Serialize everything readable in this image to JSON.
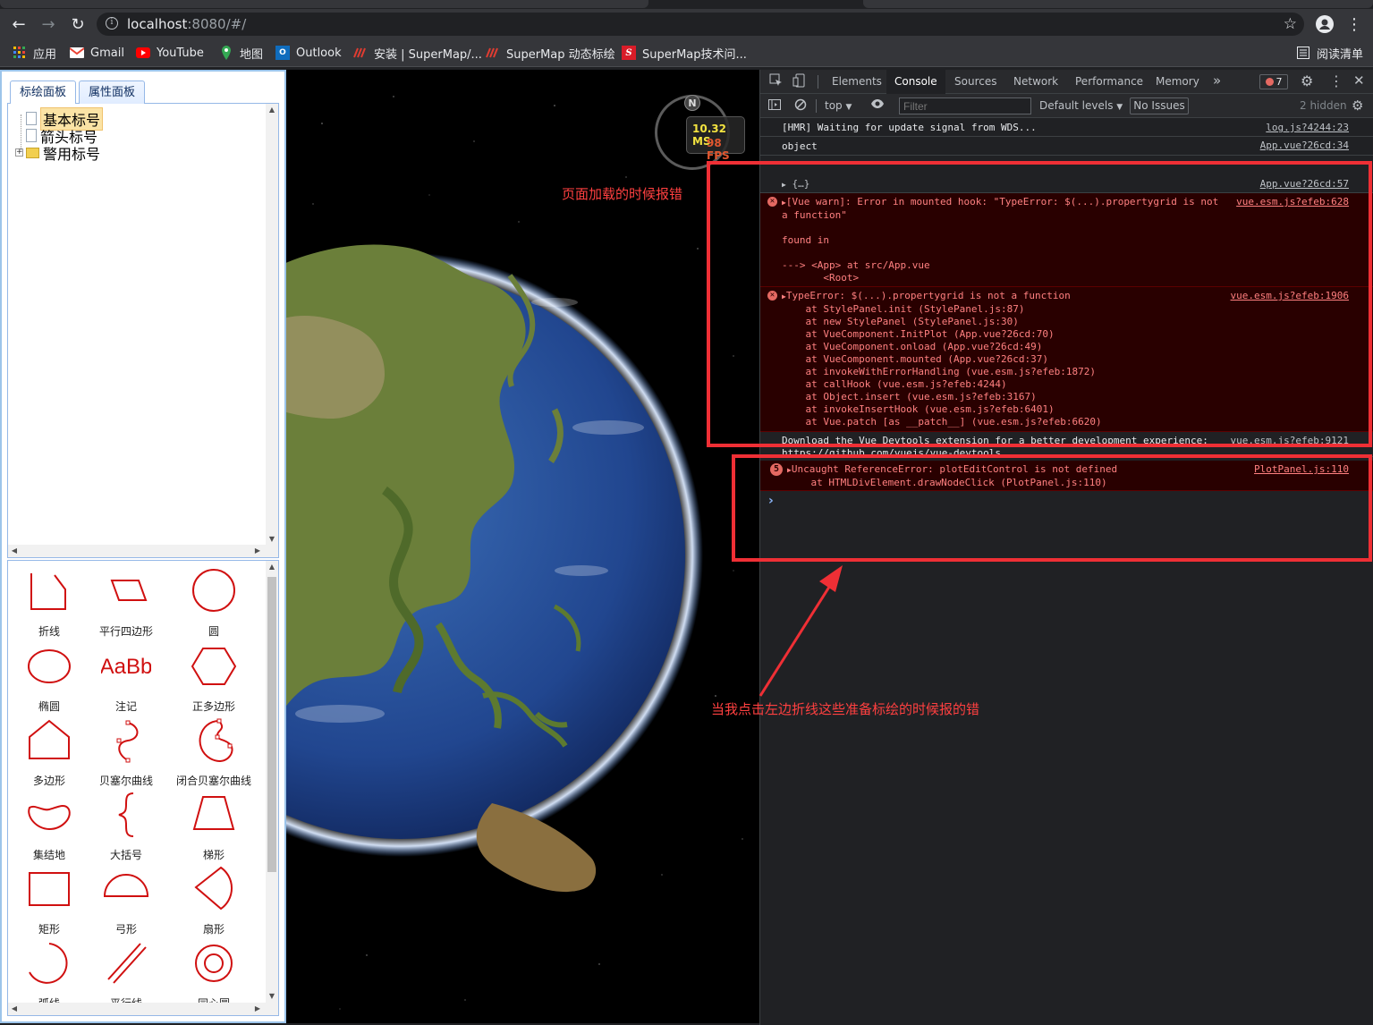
{
  "browser": {
    "url_host": "localhost",
    "url_path": ":8080/#/",
    "bookmarks": [
      {
        "label": "应用",
        "icon": "apps-grid-icon",
        "color": "#fbbc04"
      },
      {
        "label": "Gmail",
        "icon": "gmail-icon",
        "color": "#ea4335"
      },
      {
        "label": "YouTube",
        "icon": "youtube-icon",
        "color": "#ff0000"
      },
      {
        "label": "地图",
        "icon": "maps-icon",
        "color": "#34a853"
      },
      {
        "label": "Outlook",
        "icon": "outlook-icon",
        "color": "#0f6cbd"
      },
      {
        "label": "安装 | SuperMap/...",
        "icon": "supermap-icon",
        "color": "#e03c31"
      },
      {
        "label": "SuperMap 动态标绘",
        "icon": "supermap-icon",
        "color": "#e03c31"
      },
      {
        "label": "SuperMap技术问...",
        "icon": "supermap-s-icon",
        "color": "#d91c28"
      }
    ],
    "reading_list": "阅读清单"
  },
  "left_panel": {
    "tabs": [
      {
        "label": "标绘面板"
      },
      {
        "label": "属性面板"
      }
    ],
    "tree": [
      {
        "label": "基本标号",
        "type": "file",
        "selected": true
      },
      {
        "label": "箭头标号",
        "type": "file",
        "selected": false
      },
      {
        "label": "警用标号",
        "type": "folder",
        "selected": false
      }
    ],
    "gallery": [
      {
        "label": "折线",
        "icon": "polyline-icon"
      },
      {
        "label": "平行四边形",
        "icon": "parallelogram-icon"
      },
      {
        "label": "圆",
        "icon": "circle-icon"
      },
      {
        "label": "椭圆",
        "icon": "ellipse-icon"
      },
      {
        "label": "注记",
        "icon": "text-annotation-icon",
        "text": "AaBb"
      },
      {
        "label": "正多边形",
        "icon": "hexagon-icon"
      },
      {
        "label": "多边形",
        "icon": "polygon-icon"
      },
      {
        "label": "贝塞尔曲线",
        "icon": "bezier-curve-icon"
      },
      {
        "label": "闭合贝塞尔曲线",
        "icon": "closed-bezier-icon"
      },
      {
        "label": "集结地",
        "icon": "assembly-area-icon"
      },
      {
        "label": "大括号",
        "icon": "brace-icon"
      },
      {
        "label": "梯形",
        "icon": "trapezoid-icon"
      },
      {
        "label": "矩形",
        "icon": "rectangle-icon"
      },
      {
        "label": "弓形",
        "icon": "bow-icon"
      },
      {
        "label": "扇形",
        "icon": "sector-icon"
      },
      {
        "label": "弧线",
        "icon": "arc-icon"
      },
      {
        "label": "平行线",
        "icon": "parallel-lines-icon"
      },
      {
        "label": "同心圆",
        "icon": "concentric-circles-icon"
      }
    ]
  },
  "globe": {
    "compass_letter": "N",
    "ms": "10.32 MS",
    "fps": "98 FPS"
  },
  "devtools": {
    "tabs": [
      "Elements",
      "Console",
      "Sources",
      "Network",
      "Performance",
      "Memory"
    ],
    "active_tab": "Console",
    "error_count": "7",
    "context": "top",
    "filter_placeholder": "Filter",
    "levels": "Default levels",
    "issues": "No Issues",
    "hidden": "2 hidden",
    "logs": {
      "hmr": {
        "text": "[HMR] Waiting for update signal from WDS...",
        "src": "log.js?4244:23"
      },
      "object": {
        "text": "object",
        "src": "App.vue?26cd:34"
      },
      "obj2": {
        "text": "{…}",
        "src": "App.vue?26cd:57"
      },
      "vue_warn": {
        "lines": [
          "[Vue warn]: Error in mounted hook: \"TypeError: $(...).propertygrid is not",
          "a function\"",
          "",
          "found in",
          "",
          "---> <App> at src/App.vue",
          "       <Root>"
        ],
        "src": "vue.esm.js?efeb:628"
      },
      "type_error": {
        "lines": [
          "TypeError: $(...).propertygrid is not a function",
          "    at StylePanel.init (StylePanel.js:87)",
          "    at new StylePanel (StylePanel.js:30)",
          "    at VueComponent.InitPlot (App.vue?26cd:70)",
          "    at VueComponent.onload (App.vue?26cd:49)",
          "    at VueComponent.mounted (App.vue?26cd:37)",
          "    at invokeWithErrorHandling (vue.esm.js?efeb:1872)",
          "    at callHook (vue.esm.js?efeb:4244)",
          "    at Object.insert (vue.esm.js?efeb:3167)",
          "    at invokeInsertHook (vue.esm.js?efeb:6401)",
          "    at Vue.patch [as __patch__] (vue.esm.js?efeb:6620)"
        ],
        "src": "vue.esm.js?efeb:1906"
      },
      "devtools_msg": {
        "lines": [
          "Download the Vue Devtools extension for a better development experience:",
          "https://github.com/vuejs/vue-devtools"
        ],
        "src": "vue.esm.js?efeb:9121"
      },
      "ref_error": {
        "count": "5",
        "lines": [
          "Uncaught ReferenceError: plotEditControl is not defined",
          "    at HTMLDivElement.drawNodeClick (PlotPanel.js:110)"
        ],
        "src": "PlotPanel.js:110"
      }
    }
  },
  "annotations": {
    "load_error": "页面加载的时候报错",
    "click_error": "当我点击左边折线这些准备标绘的时候报的错"
  }
}
